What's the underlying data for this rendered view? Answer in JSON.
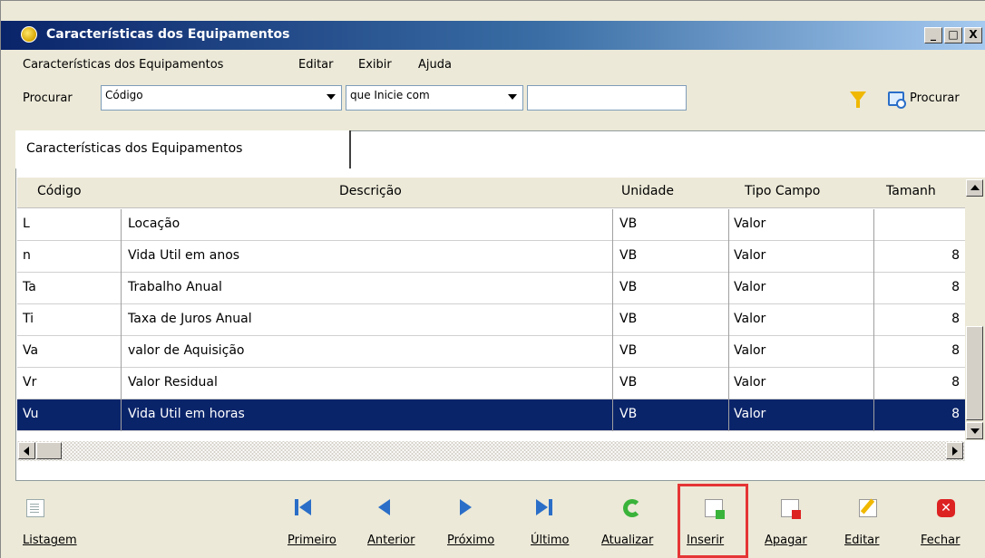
{
  "window": {
    "title": "Características dos Equipamentos",
    "controls": {
      "minimize": "_",
      "maximize": "□",
      "close": "X"
    }
  },
  "menu": [
    "Características dos Equipamentos",
    "Editar",
    "Exibir",
    "Ajuda"
  ],
  "search": {
    "label": "Procurar",
    "field_value": "Código",
    "condition_value": "que Inicie com",
    "input_value": "",
    "button_label": "Procurar"
  },
  "tab": {
    "label": "Características dos Equipamentos"
  },
  "grid": {
    "headers": [
      "Código",
      "Descrição",
      "Unidade",
      "Tipo Campo",
      "Tamanh"
    ],
    "rows": [
      {
        "codigo": "L",
        "descricao": "Locação",
        "unidade": "VB",
        "tipo": "Valor",
        "tamanho": ""
      },
      {
        "codigo": "n",
        "descricao": "Vida Util em anos",
        "unidade": "VB",
        "tipo": "Valor",
        "tamanho": "8"
      },
      {
        "codigo": "Ta",
        "descricao": "Trabalho Anual",
        "unidade": "VB",
        "tipo": "Valor",
        "tamanho": "8"
      },
      {
        "codigo": "Ti",
        "descricao": "Taxa de Juros Anual",
        "unidade": "VB",
        "tipo": "Valor",
        "tamanho": "8"
      },
      {
        "codigo": "Va",
        "descricao": "valor de Aquisição",
        "unidade": "VB",
        "tipo": "Valor",
        "tamanho": "8"
      },
      {
        "codigo": "Vr",
        "descricao": "Valor Residual",
        "unidade": "VB",
        "tipo": "Valor",
        "tamanho": "8"
      },
      {
        "codigo": "Vu",
        "descricao": "Vida Util em horas",
        "unidade": "VB",
        "tipo": "Valor",
        "tamanho": "8"
      }
    ],
    "selected_row": 6
  },
  "toolbar": {
    "listagem": "Listagem",
    "primeiro": "Primeiro",
    "anterior": "Anterior",
    "proximo": "Próximo",
    "ultimo": "Último",
    "atualizar": "Atualizar",
    "inserir": "Inserir",
    "apagar": "Apagar",
    "editar": "Editar",
    "fechar": "Fechar"
  },
  "colors": {
    "selection": "#0a246a",
    "title_start": "#0a246a",
    "highlight": "#e53535",
    "nav_blue": "#2a6ec8"
  }
}
